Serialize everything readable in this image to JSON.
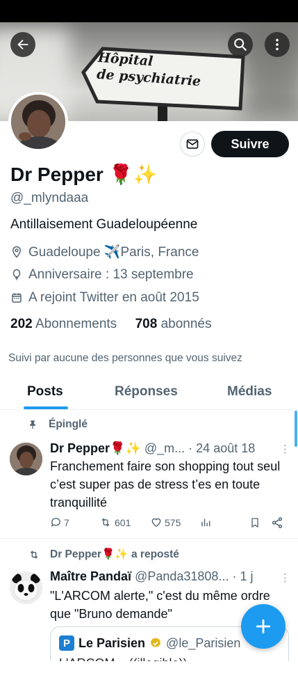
{
  "banner": {
    "sign_text": "Hôpital\nde psychiatrie"
  },
  "profile": {
    "name": "Dr Pepper",
    "name_emoji": "🌹✨",
    "handle": "@_mlyndaaa",
    "bio": "Antillaisement Guadeloupéenne",
    "location": "Guadeloupe ✈️Paris, France",
    "birthday": "Anniversaire : 13 septembre",
    "joined": "A rejoint Twitter en août 2015",
    "following_count": "202",
    "following_label": "Abonnements",
    "followers_count": "708",
    "followers_label": "abonnés",
    "followed_by": "Suivi par aucune des personnes que vous suivez"
  },
  "buttons": {
    "follow_label": "Suivre"
  },
  "tabs": [
    {
      "label": "Posts",
      "active": true
    },
    {
      "label": "Réponses",
      "active": false
    },
    {
      "label": "Médias",
      "active": false
    }
  ],
  "pinned_tweet": {
    "pinned_label": "Épinglé",
    "name": "Dr Pepper🌹✨",
    "handle": "@_m...",
    "date": "· 24 août 18",
    "text": "Franchement faire son shopping tout seul c’est super pas de stress t’es en toute tranquillité",
    "replies": "7",
    "retweets": "601",
    "likes": "575"
  },
  "repost_tweet": {
    "repost_label": "Dr Pepper🌹✨ a reposté",
    "name": "Maître Pandaï",
    "handle": "@Panda31808...",
    "date": "· 1 j",
    "text": "\"L'ARCOM alerte,\" c'est du même ordre que \"Bruno demande\"",
    "quote": {
      "logo_letter": "P",
      "name": "Le Parisien",
      "handle": "@le_Parisien",
      "clipped_text": "L'ARCOM... ((illegible))"
    }
  },
  "colors": {
    "accent": "#1d9bf0",
    "text": "#0f1419",
    "secondary": "#536471",
    "verified_gold": "#e2b719"
  },
  "icons": {
    "back": "arrow-left-icon",
    "search": "search-icon",
    "more": "more-vertical-icon",
    "message": "mail-icon",
    "location": "location-pin-icon",
    "birthday": "balloon-icon",
    "calendar": "calendar-icon",
    "pin": "pin-icon",
    "repost": "repost-icon",
    "compose": "plus-icon"
  }
}
